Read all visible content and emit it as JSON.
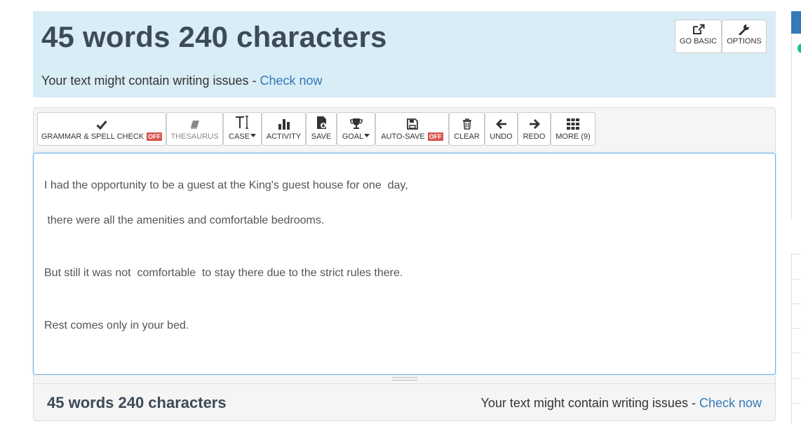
{
  "header": {
    "title": "45 words 240 characters",
    "issues_text": "Your text might contain writing issues - ",
    "check_now": "Check now",
    "go_basic": "GO BASIC",
    "options": "OPTIONS"
  },
  "toolbar": {
    "grammar": "GRAMMAR & SPELL CHECK",
    "grammar_state": "OFF",
    "thesaurus": "THESAURUS",
    "case": "CASE",
    "activity": "ACTIVITY",
    "save": "SAVE",
    "goal": "GOAL",
    "autosave": "AUTO-SAVE",
    "autosave_state": "OFF",
    "clear": "CLEAR",
    "undo": "UNDO",
    "redo": "REDO",
    "more": "MORE (9)"
  },
  "editor": {
    "lines": [
      "I had the opportunity to be a guest at the King's guest house for one  day,",
      " there were all the amenities and comfortable bedrooms.",
      "But still it was not  comfortable  to stay there due to the strict rules there.",
      "Rest comes only in your bed."
    ]
  },
  "footer": {
    "title": "45 words 240 characters",
    "issues_text": "Your text might contain writing issues - ",
    "check_now": "Check now"
  },
  "colors": {
    "header_bg": "#d9edf7",
    "link": "#337ab7",
    "off_badge": "#d9534f",
    "editor_focus": "#66afe9"
  },
  "icons": [
    "external-link-icon",
    "wrench-icon",
    "check-icon",
    "book-icon",
    "text-case-icon",
    "bar-chart-icon",
    "save-file-icon",
    "trophy-icon",
    "floppy-disk-icon",
    "trash-icon",
    "arrow-left-icon",
    "arrow-right-icon",
    "grid-icon"
  ]
}
